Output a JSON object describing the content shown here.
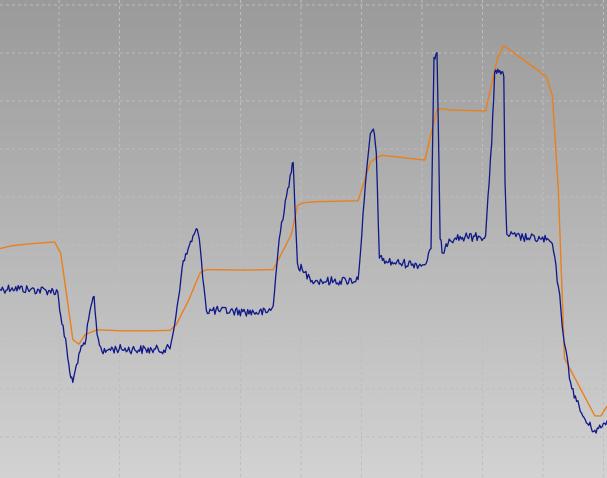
{
  "chart_data": {
    "type": "line",
    "grid": true,
    "legend": "none",
    "xlim": [
      0,
      100
    ],
    "ylim": [
      0,
      100
    ],
    "background": {
      "top": "#9a9a9a",
      "bottom": "#d2d2d2"
    },
    "grid_color": "#bdbdbd",
    "series": [
      {
        "color": "#e8801c",
        "x": [
          0,
          2,
          5,
          9,
          10,
          11,
          12,
          13,
          14,
          16,
          20,
          25,
          28,
          29,
          31,
          33,
          34,
          40,
          45,
          46,
          48,
          49,
          50,
          52,
          59,
          60,
          61,
          62,
          63,
          70,
          71,
          72,
          73,
          74,
          80,
          82,
          83,
          90,
          91,
          92,
          93,
          98,
          99,
          100
        ],
        "y": [
          48,
          48.6,
          49,
          49.4,
          47,
          38,
          29,
          28,
          30,
          31,
          30.8,
          30.8,
          30.9,
          32,
          37,
          43,
          43.6,
          43.5,
          43.6,
          46,
          51,
          57,
          57.6,
          57.8,
          58,
          62,
          66,
          67,
          67.5,
          66.5,
          72,
          77,
          77.3,
          77,
          76.8,
          88,
          90.5,
          84,
          80,
          60,
          25,
          13,
          13,
          15
        ]
      },
      {
        "color": "#0f1888",
        "x": [
          0,
          2,
          5,
          8,
          9.5,
          10,
          11,
          11.5,
          12,
          13,
          14,
          15,
          15.5,
          16,
          17,
          18,
          20,
          25,
          28,
          29,
          30,
          31,
          32,
          32.5,
          33,
          34,
          36,
          40,
          44,
          45,
          46,
          47,
          48,
          48.3,
          48.6,
          49,
          50,
          51,
          52,
          53,
          55,
          57,
          59,
          60,
          61,
          61.5,
          62,
          62.5,
          63,
          65,
          68,
          70,
          71,
          71.5,
          72,
          72.5,
          73,
          73.5,
          74,
          75,
          77,
          79,
          80,
          81,
          81.5,
          82,
          82.5,
          83,
          83.2,
          83.5,
          84,
          85,
          87,
          89,
          90,
          91,
          92,
          93,
          94,
          95,
          96,
          97,
          98,
          99,
          100
        ],
        "y": [
          39.5,
          39.8,
          39.4,
          39.2,
          39,
          34,
          27,
          22,
          20,
          26,
          28,
          36,
          38,
          30,
          26,
          27,
          27,
          26.8,
          27,
          34,
          44,
          48,
          51,
          52,
          48,
          35,
          35,
          34.8,
          34.6,
          36,
          50,
          58,
          64,
          66,
          56,
          45,
          43,
          42,
          41.3,
          41.2,
          41.2,
          41.3,
          41.5,
          58,
          72,
          73,
          68,
          46,
          45.5,
          45,
          44.8,
          44.6,
          48,
          88,
          89,
          50,
          47,
          49,
          50,
          50.2,
          50.4,
          50.5,
          50.7,
          70,
          85,
          85.5,
          84.5,
          84,
          62,
          51,
          50.8,
          50.5,
          50.2,
          50,
          49.8,
          49,
          40,
          28,
          20,
          16,
          13,
          11,
          10,
          10.5,
          12
        ]
      }
    ]
  }
}
